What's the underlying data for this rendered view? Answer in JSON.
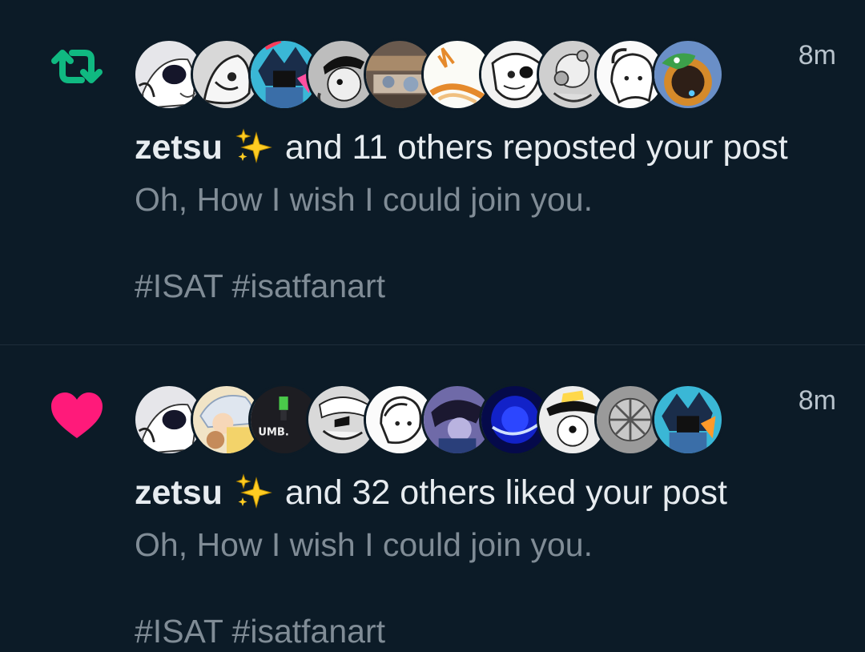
{
  "colors": {
    "background": "#0c1b27",
    "repost_green": "#10b981",
    "like_pink": "#ff1a7a",
    "primary_text": "#e7ecf0",
    "secondary_text": "#808c96",
    "divider": "#1e2d3a"
  },
  "notifications": [
    {
      "type": "repost",
      "icon": "repost-icon",
      "time": "8m",
      "actor_name": "zetsu",
      "actor_emoji": "sparkles-emoji",
      "action_text": "and 11 others reposted your post",
      "post_text": "Oh, How I wish I could join you.",
      "post_tags": "#ISAT #isatfanart",
      "avatar_count": 10
    },
    {
      "type": "like",
      "icon": "heart-icon",
      "time": "8m",
      "actor_name": "zetsu",
      "actor_emoji": "sparkles-emoji",
      "action_text": "and 32 others liked your post",
      "post_text": "Oh, How I wish I could join you.",
      "post_tags": "#ISAT #isatfanart",
      "avatar_count": 10
    }
  ]
}
